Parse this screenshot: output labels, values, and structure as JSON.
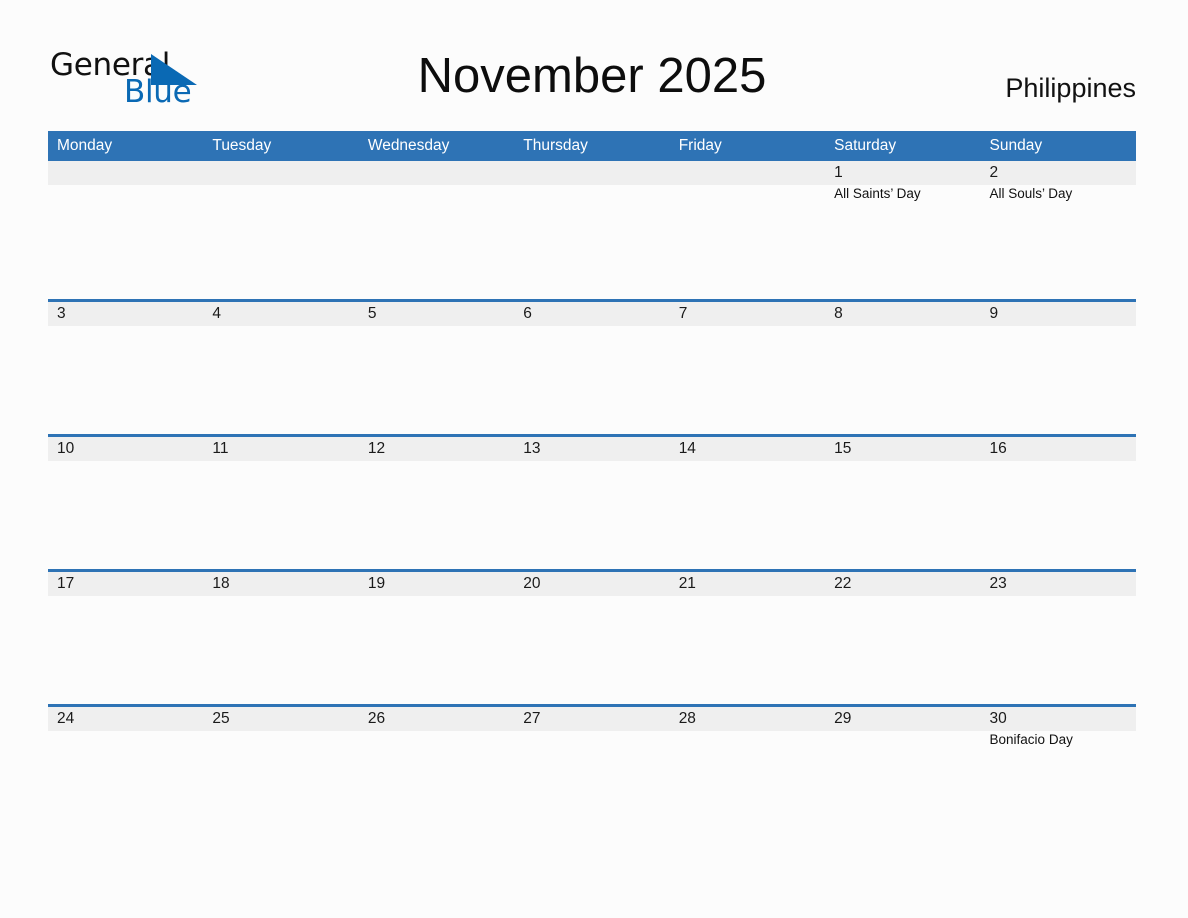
{
  "brand": {
    "name_part1": "General",
    "name_part2": "Blue",
    "triangle_icon": "triangle-icon",
    "accent_color": "#0a69b4"
  },
  "header": {
    "title": "November 2025",
    "country": "Philippines"
  },
  "colors": {
    "header_blue": "#2e73b5",
    "date_band_gray": "#efefef",
    "page_background": "#fcfcfc",
    "text": "#1a1a1a",
    "header_text": "#ffffff"
  },
  "weekdays": [
    "Monday",
    "Tuesday",
    "Wednesday",
    "Thursday",
    "Friday",
    "Saturday",
    "Sunday"
  ],
  "weeks": [
    {
      "days": [
        {
          "num": "",
          "event": ""
        },
        {
          "num": "",
          "event": ""
        },
        {
          "num": "",
          "event": ""
        },
        {
          "num": "",
          "event": ""
        },
        {
          "num": "",
          "event": ""
        },
        {
          "num": "1",
          "event": "All Saints’ Day"
        },
        {
          "num": "2",
          "event": "All Souls’ Day"
        }
      ]
    },
    {
      "days": [
        {
          "num": "3",
          "event": ""
        },
        {
          "num": "4",
          "event": ""
        },
        {
          "num": "5",
          "event": ""
        },
        {
          "num": "6",
          "event": ""
        },
        {
          "num": "7",
          "event": ""
        },
        {
          "num": "8",
          "event": ""
        },
        {
          "num": "9",
          "event": ""
        }
      ]
    },
    {
      "days": [
        {
          "num": "10",
          "event": ""
        },
        {
          "num": "11",
          "event": ""
        },
        {
          "num": "12",
          "event": ""
        },
        {
          "num": "13",
          "event": ""
        },
        {
          "num": "14",
          "event": ""
        },
        {
          "num": "15",
          "event": ""
        },
        {
          "num": "16",
          "event": ""
        }
      ]
    },
    {
      "days": [
        {
          "num": "17",
          "event": ""
        },
        {
          "num": "18",
          "event": ""
        },
        {
          "num": "19",
          "event": ""
        },
        {
          "num": "20",
          "event": ""
        },
        {
          "num": "21",
          "event": ""
        },
        {
          "num": "22",
          "event": ""
        },
        {
          "num": "23",
          "event": ""
        }
      ]
    },
    {
      "days": [
        {
          "num": "24",
          "event": ""
        },
        {
          "num": "25",
          "event": ""
        },
        {
          "num": "26",
          "event": ""
        },
        {
          "num": "27",
          "event": ""
        },
        {
          "num": "28",
          "event": ""
        },
        {
          "num": "29",
          "event": ""
        },
        {
          "num": "30",
          "event": "Bonifacio Day"
        }
      ]
    }
  ]
}
